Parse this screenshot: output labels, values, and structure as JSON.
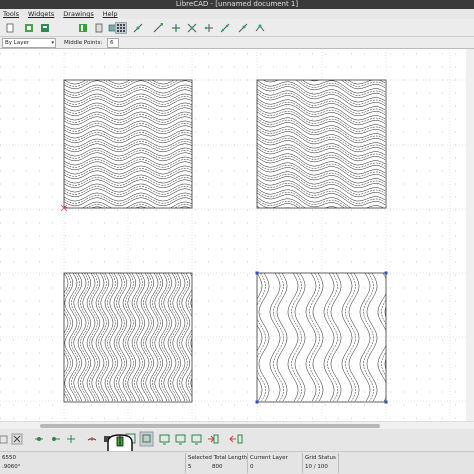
{
  "window": {
    "title": "LibreCAD - [unnamed document 1]"
  },
  "menu": {
    "items": [
      "Tools",
      "Widgets",
      "Drawings",
      "Help"
    ]
  },
  "toolbar2": {
    "layer_combo": "By Layer",
    "snap_label": "Middle Points:",
    "snap_value": "6"
  },
  "status": {
    "coord_abs": "6550",
    "coord_rel": ".9060°",
    "selected_total_length_label": "Selected Total Length",
    "selected_count": "5",
    "selected_length": "800",
    "current_layer_label": "Current Layer",
    "current_layer_value": "0",
    "grid_status_label": "Grid Status",
    "grid_status_value": "10 / 100"
  },
  "colors": {
    "grid_line": "#d9dde3",
    "grid_dot": "#a8adb5",
    "drawing": "#222222",
    "selection_handle": "#3050c0",
    "origin_marker": "#e04040"
  },
  "icons": [
    "tools-grid-icon",
    "line-icon",
    "circle-icon",
    "arc-icon",
    "rectangle-icon",
    "text-icon",
    "dimension-icon",
    "move-icon",
    "rotate-icon",
    "scale-icon",
    "mirror-icon",
    "trim-icon",
    "snap-free-icon",
    "snap-grid-icon",
    "snap-end-icon",
    "snap-middle-icon",
    "snap-center-icon",
    "snap-intersect-icon",
    "restrict-icon",
    "block-icon"
  ]
}
